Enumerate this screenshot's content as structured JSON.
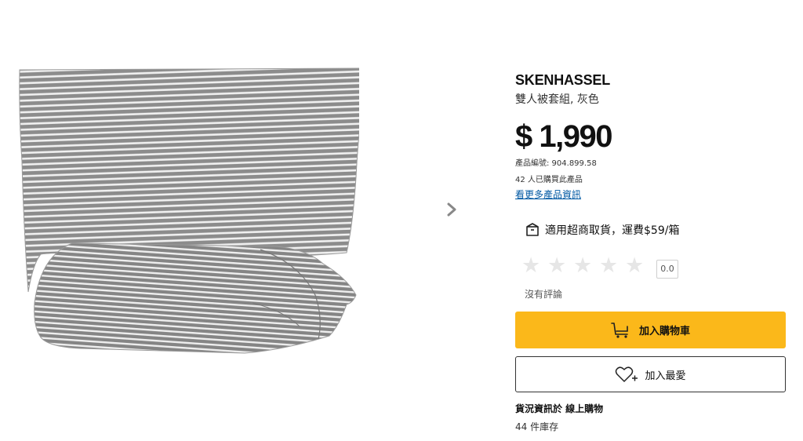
{
  "product": {
    "name": "SKENHASSEL",
    "description": "雙人被套組, 灰色",
    "price": "$ 1,990",
    "article_number": "產品編號: 904.899.58",
    "bought_count": "42 人已購買此產品",
    "more_info_link": "看更多產品資訊"
  },
  "delivery": {
    "text": "適用超商取貨，運費$59/箱",
    "icon": "box-icon"
  },
  "rating": {
    "value": "0.0",
    "stars": 0,
    "max_stars": 5,
    "no_review_text": "沒有評論"
  },
  "actions": {
    "add_to_cart": "加入購物車",
    "add_to_favorites": "加入最愛"
  },
  "stock": {
    "title": "貨況資訊於 線上購物",
    "count": "44 件庫存"
  },
  "colors": {
    "accent": "#fbb81a",
    "link": "#0058a3"
  }
}
